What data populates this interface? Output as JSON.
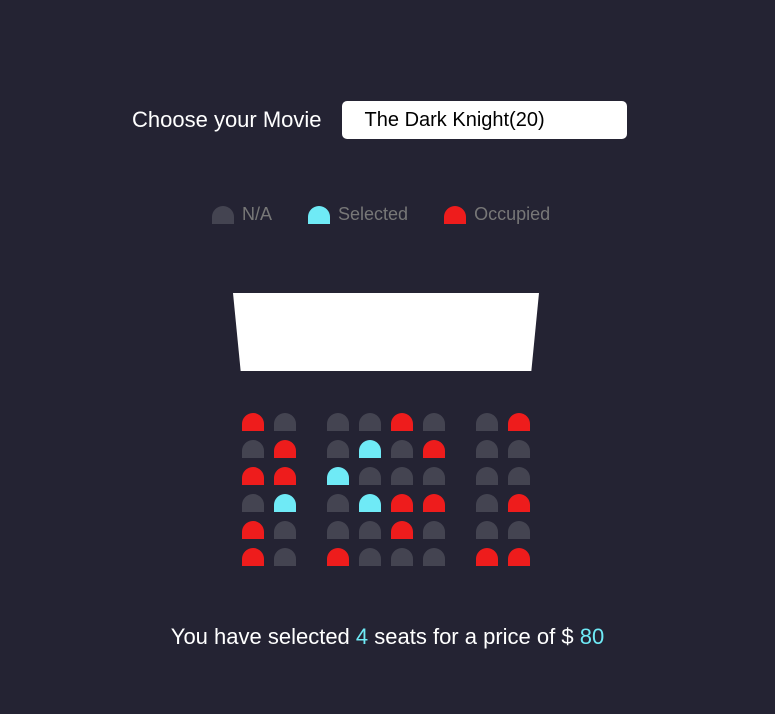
{
  "movie": {
    "label": "Choose your Movie",
    "selected": "The Dark Knight(20)"
  },
  "legend": [
    {
      "label": "N/A",
      "state": "na"
    },
    {
      "label": "Selected",
      "state": "selected"
    },
    {
      "label": "Occupied",
      "state": "occupied"
    }
  ],
  "colors": {
    "background": "#242333",
    "na": "#444451",
    "selected": "#6feaf6",
    "occupied": "#ee1c1c",
    "screen": "#ffffff"
  },
  "seats": [
    [
      "occupied",
      "na",
      "na",
      "na",
      "occupied",
      "na",
      "na",
      "occupied"
    ],
    [
      "na",
      "occupied",
      "na",
      "selected",
      "na",
      "occupied",
      "na",
      "na"
    ],
    [
      "occupied",
      "occupied",
      "selected",
      "na",
      "na",
      "na",
      "na",
      "na"
    ],
    [
      "na",
      "selected",
      "na",
      "selected",
      "occupied",
      "occupied",
      "na",
      "occupied"
    ],
    [
      "occupied",
      "na",
      "na",
      "na",
      "occupied",
      "na",
      "na",
      "na"
    ],
    [
      "occupied",
      "na",
      "occupied",
      "na",
      "na",
      "na",
      "occupied",
      "occupied"
    ]
  ],
  "summary": {
    "prefix": "You have selected ",
    "count": "4",
    "middle": " seats for a price of $ ",
    "price": "80"
  }
}
